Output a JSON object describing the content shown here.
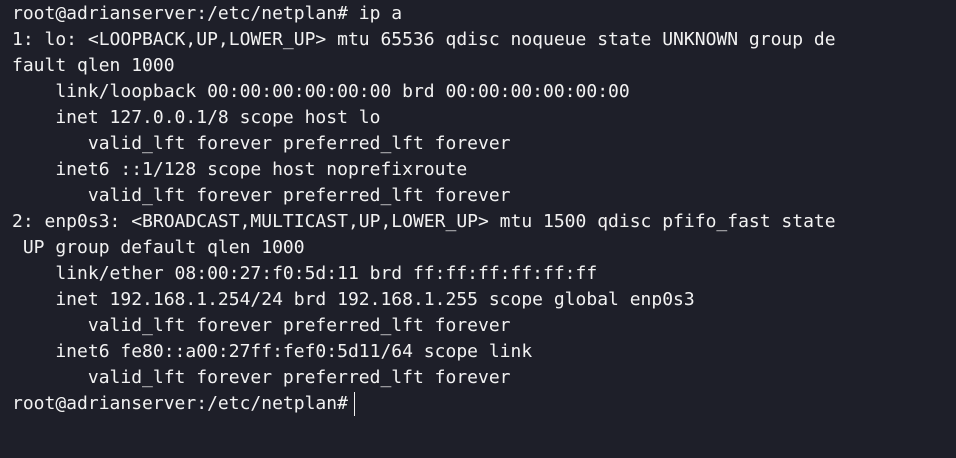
{
  "terminal": {
    "background": "#1e1f29",
    "foreground": "#f2f2f2",
    "lines": [
      "root@adrianserver:/etc/netplan# ip a",
      "1: lo: <LOOPBACK,UP,LOWER_UP> mtu 65536 qdisc noqueue state UNKNOWN group de",
      "fault qlen 1000",
      "    link/loopback 00:00:00:00:00:00 brd 00:00:00:00:00:00",
      "    inet 127.0.0.1/8 scope host lo",
      "       valid_lft forever preferred_lft forever",
      "    inet6 ::1/128 scope host noprefixroute",
      "       valid_lft forever preferred_lft forever",
      "2: enp0s3: <BROADCAST,MULTICAST,UP,LOWER_UP> mtu 1500 qdisc pfifo_fast state",
      " UP group default qlen 1000",
      "    link/ether 08:00:27:f0:5d:11 brd ff:ff:ff:ff:ff:ff",
      "    inet 192.168.1.254/24 brd 192.168.1.255 scope global enp0s3",
      "       valid_lft forever preferred_lft forever",
      "    inet6 fe80::a00:27ff:fef0:5d11/64 scope link",
      "       valid_lft forever preferred_lft forever"
    ],
    "prompt": "root@adrianserver:/etc/netplan#"
  }
}
